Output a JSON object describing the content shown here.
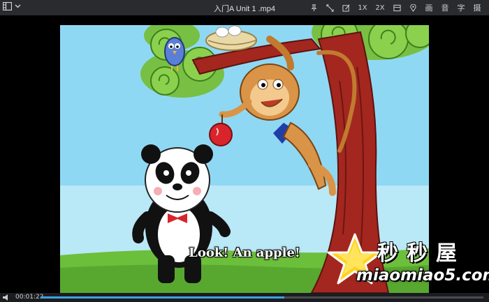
{
  "window": {
    "title": "入门A Unit 1 .mp4",
    "icons": [
      "playlist-icon",
      "chevron-down-icon"
    ]
  },
  "toolbar": {
    "pin_icon": "pin-icon",
    "fullscreen_icon": "expand-icon",
    "screenshot_icon": "edit-icon",
    "speed_1x": "1X",
    "speed_2x": "2X",
    "aspect_icon": "aspect-icon",
    "location_icon": "location-icon",
    "picture_label": "画",
    "audio_label": "音",
    "subtitle_label": "字",
    "capture_label": "摄"
  },
  "video": {
    "subtitle": "Look! An apple!"
  },
  "watermark": {
    "chinese": "秒秒屋",
    "url": "miaomiao5.com"
  },
  "controls": {
    "volume_icon": "volume-icon",
    "current_time": "00:01:22",
    "progress": 0.55,
    "accent_color": "#3ea3e0"
  }
}
